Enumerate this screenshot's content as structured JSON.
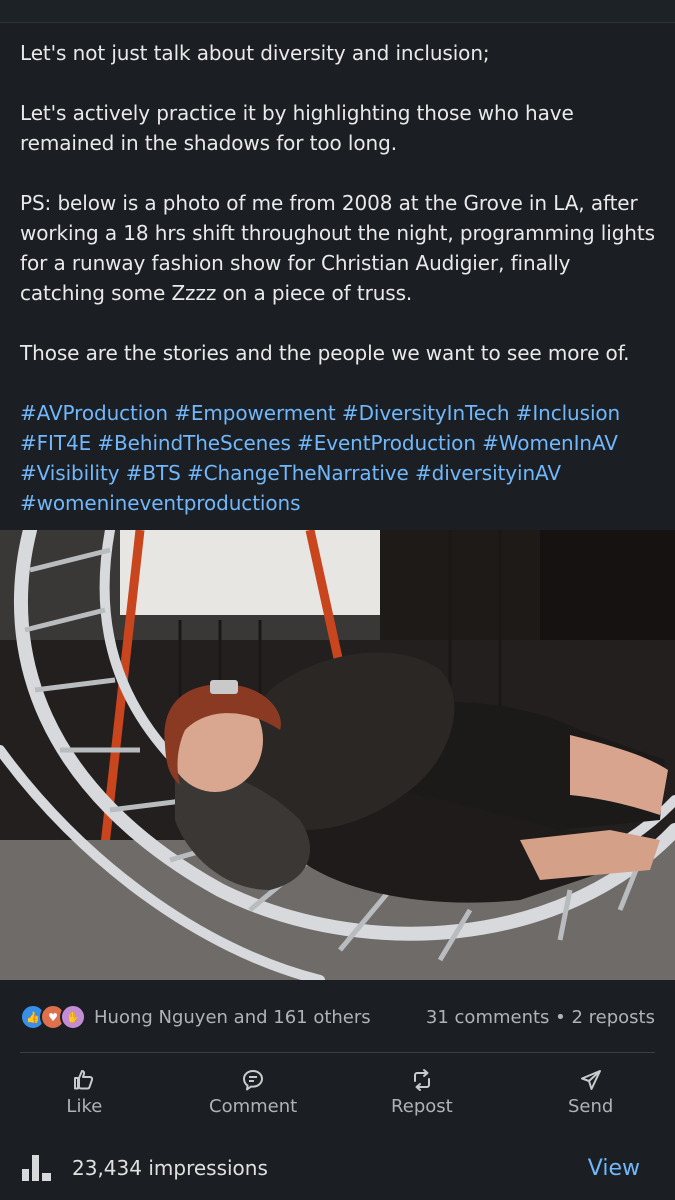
{
  "post": {
    "paragraphs": [
      "Let's not just talk about diversity and inclusion;",
      "Let's actively practice it by highlighting those who have remained in the shadows for too long.",
      "PS: below is a photo of me from 2008 at the Grove in LA, after working a 18 hrs shift throughout the night, programming lights for a runway fashion show for Christian Audigier, finally catching some Zzzz on a piece of truss.",
      "Those are the stories and the people we want to see more of."
    ],
    "hashtags": "#AVProduction #Empowerment #DiversityInTech #Inclusion #FIT4E #BehindTheScenes #EventProduction #WomenInAV #Visibility #BTS #ChangeTheNarrative #diversityinAV #womenineventproductions"
  },
  "stats": {
    "reactors_text": "Huong Nguyen and 161 others",
    "comments_reposts": "31 comments • 2 reposts",
    "reaction_icons": [
      "like-icon",
      "love-icon",
      "support-icon"
    ]
  },
  "actions": {
    "like": "Like",
    "comment": "Comment",
    "repost": "Repost",
    "send": "Send"
  },
  "impressions": {
    "text": "23,434 impressions",
    "view_label": "View"
  },
  "colors": {
    "background": "#1b1f23",
    "text": "#e9e9ea",
    "link": "#71b7fb",
    "muted": "#b0b3b6"
  }
}
